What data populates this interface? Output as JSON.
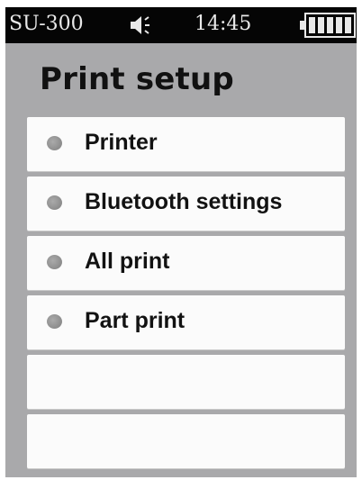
{
  "status_bar": {
    "model": "SU-300",
    "time": "14:45",
    "speaker_icon": "speaker-volume-icon",
    "battery_icon": "battery-full-icon",
    "battery_level": 1.0
  },
  "page": {
    "title": "Print setup"
  },
  "menu": {
    "items": [
      {
        "label": "Printer",
        "bullet_icon": "bullet-dot-icon"
      },
      {
        "label": "Bluetooth settings",
        "bullet_icon": "bullet-dot-icon"
      },
      {
        "label": "All print",
        "bullet_icon": "bullet-dot-icon"
      },
      {
        "label": "Part print",
        "bullet_icon": "bullet-dot-icon"
      },
      {
        "label": ""
      },
      {
        "label": ""
      }
    ]
  },
  "colors": {
    "status_bar_bg": "#050505",
    "screen_bg": "#a9a9ab",
    "item_bg": "#fbfbfb",
    "bullet": "#8c8c8c"
  }
}
